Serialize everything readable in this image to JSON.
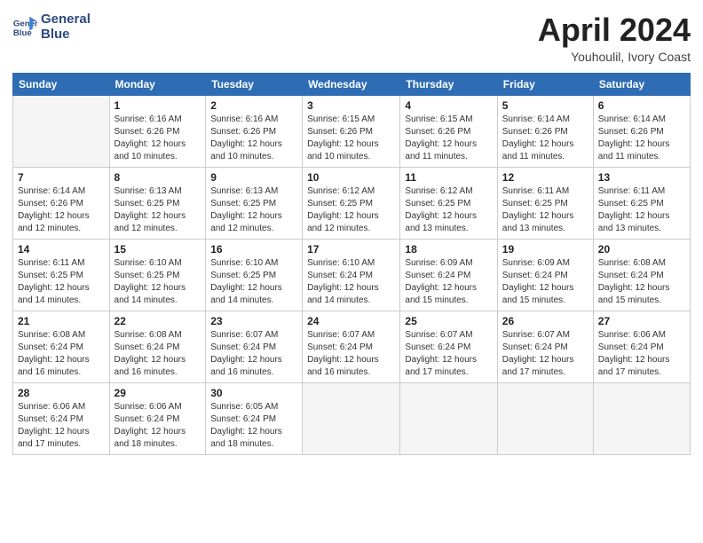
{
  "logo": {
    "line1": "General",
    "line2": "Blue"
  },
  "title": "April 2024",
  "location": "Youhoulil, Ivory Coast",
  "days_header": [
    "Sunday",
    "Monday",
    "Tuesday",
    "Wednesday",
    "Thursday",
    "Friday",
    "Saturday"
  ],
  "weeks": [
    [
      {
        "num": "",
        "info": ""
      },
      {
        "num": "1",
        "info": "Sunrise: 6:16 AM\nSunset: 6:26 PM\nDaylight: 12 hours\nand 10 minutes."
      },
      {
        "num": "2",
        "info": "Sunrise: 6:16 AM\nSunset: 6:26 PM\nDaylight: 12 hours\nand 10 minutes."
      },
      {
        "num": "3",
        "info": "Sunrise: 6:15 AM\nSunset: 6:26 PM\nDaylight: 12 hours\nand 10 minutes."
      },
      {
        "num": "4",
        "info": "Sunrise: 6:15 AM\nSunset: 6:26 PM\nDaylight: 12 hours\nand 11 minutes."
      },
      {
        "num": "5",
        "info": "Sunrise: 6:14 AM\nSunset: 6:26 PM\nDaylight: 12 hours\nand 11 minutes."
      },
      {
        "num": "6",
        "info": "Sunrise: 6:14 AM\nSunset: 6:26 PM\nDaylight: 12 hours\nand 11 minutes."
      }
    ],
    [
      {
        "num": "7",
        "info": "Sunrise: 6:14 AM\nSunset: 6:26 PM\nDaylight: 12 hours\nand 12 minutes."
      },
      {
        "num": "8",
        "info": "Sunrise: 6:13 AM\nSunset: 6:25 PM\nDaylight: 12 hours\nand 12 minutes."
      },
      {
        "num": "9",
        "info": "Sunrise: 6:13 AM\nSunset: 6:25 PM\nDaylight: 12 hours\nand 12 minutes."
      },
      {
        "num": "10",
        "info": "Sunrise: 6:12 AM\nSunset: 6:25 PM\nDaylight: 12 hours\nand 12 minutes."
      },
      {
        "num": "11",
        "info": "Sunrise: 6:12 AM\nSunset: 6:25 PM\nDaylight: 12 hours\nand 13 minutes."
      },
      {
        "num": "12",
        "info": "Sunrise: 6:11 AM\nSunset: 6:25 PM\nDaylight: 12 hours\nand 13 minutes."
      },
      {
        "num": "13",
        "info": "Sunrise: 6:11 AM\nSunset: 6:25 PM\nDaylight: 12 hours\nand 13 minutes."
      }
    ],
    [
      {
        "num": "14",
        "info": "Sunrise: 6:11 AM\nSunset: 6:25 PM\nDaylight: 12 hours\nand 14 minutes."
      },
      {
        "num": "15",
        "info": "Sunrise: 6:10 AM\nSunset: 6:25 PM\nDaylight: 12 hours\nand 14 minutes."
      },
      {
        "num": "16",
        "info": "Sunrise: 6:10 AM\nSunset: 6:25 PM\nDaylight: 12 hours\nand 14 minutes."
      },
      {
        "num": "17",
        "info": "Sunrise: 6:10 AM\nSunset: 6:24 PM\nDaylight: 12 hours\nand 14 minutes."
      },
      {
        "num": "18",
        "info": "Sunrise: 6:09 AM\nSunset: 6:24 PM\nDaylight: 12 hours\nand 15 minutes."
      },
      {
        "num": "19",
        "info": "Sunrise: 6:09 AM\nSunset: 6:24 PM\nDaylight: 12 hours\nand 15 minutes."
      },
      {
        "num": "20",
        "info": "Sunrise: 6:08 AM\nSunset: 6:24 PM\nDaylight: 12 hours\nand 15 minutes."
      }
    ],
    [
      {
        "num": "21",
        "info": "Sunrise: 6:08 AM\nSunset: 6:24 PM\nDaylight: 12 hours\nand 16 minutes."
      },
      {
        "num": "22",
        "info": "Sunrise: 6:08 AM\nSunset: 6:24 PM\nDaylight: 12 hours\nand 16 minutes."
      },
      {
        "num": "23",
        "info": "Sunrise: 6:07 AM\nSunset: 6:24 PM\nDaylight: 12 hours\nand 16 minutes."
      },
      {
        "num": "24",
        "info": "Sunrise: 6:07 AM\nSunset: 6:24 PM\nDaylight: 12 hours\nand 16 minutes."
      },
      {
        "num": "25",
        "info": "Sunrise: 6:07 AM\nSunset: 6:24 PM\nDaylight: 12 hours\nand 17 minutes."
      },
      {
        "num": "26",
        "info": "Sunrise: 6:07 AM\nSunset: 6:24 PM\nDaylight: 12 hours\nand 17 minutes."
      },
      {
        "num": "27",
        "info": "Sunrise: 6:06 AM\nSunset: 6:24 PM\nDaylight: 12 hours\nand 17 minutes."
      }
    ],
    [
      {
        "num": "28",
        "info": "Sunrise: 6:06 AM\nSunset: 6:24 PM\nDaylight: 12 hours\nand 17 minutes."
      },
      {
        "num": "29",
        "info": "Sunrise: 6:06 AM\nSunset: 6:24 PM\nDaylight: 12 hours\nand 18 minutes."
      },
      {
        "num": "30",
        "info": "Sunrise: 6:05 AM\nSunset: 6:24 PM\nDaylight: 12 hours\nand 18 minutes."
      },
      {
        "num": "",
        "info": ""
      },
      {
        "num": "",
        "info": ""
      },
      {
        "num": "",
        "info": ""
      },
      {
        "num": "",
        "info": ""
      }
    ]
  ]
}
